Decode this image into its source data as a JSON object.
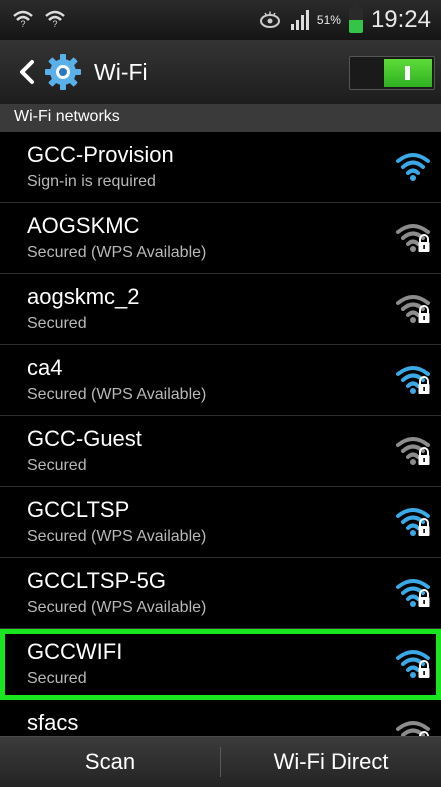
{
  "status_bar": {
    "battery_percent": "51%",
    "time": "19:24",
    "icons": [
      "wifi-notify-icon",
      "wifi-notify-icon",
      "eye-icon",
      "signal-icon",
      "battery-icon"
    ]
  },
  "action_bar": {
    "title": "Wi-Fi",
    "wifi_toggle_on": true,
    "icons": [
      "back-chevron-icon",
      "settings-gear-icon"
    ]
  },
  "section_header": "Wi-Fi networks",
  "networks": [
    {
      "name": "GCC-Provision",
      "status": "Sign-in is required",
      "secured": false,
      "signal_color": "#3aa9e6"
    },
    {
      "name": "AOGSKMC",
      "status": "Secured (WPS Available)",
      "secured": true,
      "signal_color": "#8c8c8c"
    },
    {
      "name": "aogskmc_2",
      "status": "Secured",
      "secured": true,
      "signal_color": "#8c8c8c"
    },
    {
      "name": "ca4",
      "status": "Secured (WPS Available)",
      "secured": true,
      "signal_color": "#3aa9e6"
    },
    {
      "name": "GCC-Guest",
      "status": "Secured",
      "secured": true,
      "signal_color": "#8c8c8c"
    },
    {
      "name": "GCCLTSP",
      "status": "Secured (WPS Available)",
      "secured": true,
      "signal_color": "#3aa9e6"
    },
    {
      "name": "GCCLTSP-5G",
      "status": "Secured (WPS Available)",
      "secured": true,
      "signal_color": "#3aa9e6"
    },
    {
      "name": "GCCWIFI",
      "status": "Secured",
      "secured": true,
      "signal_color": "#3aa9e6",
      "highlighted": true
    },
    {
      "name": "sfacs",
      "status": "",
      "secured": true,
      "signal_color": "#8c8c8c"
    }
  ],
  "bottom_bar": {
    "scan_label": "Scan",
    "wifi_direct_label": "Wi-Fi Direct"
  },
  "colors": {
    "accent_blue": "#3aa9e6",
    "toggle_green": "#3fc428",
    "highlight_green": "#19e61f"
  }
}
